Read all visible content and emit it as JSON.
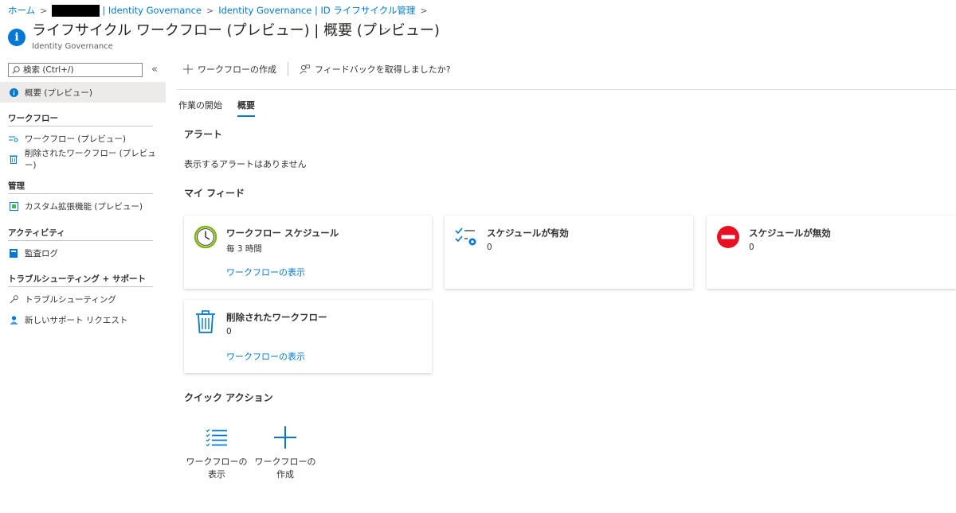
{
  "breadcrumb": {
    "home": "ホーム",
    "tenant_suffix": "| Identity Governance",
    "item2": "Identity Governance | ID ライフサイクル管理"
  },
  "header": {
    "title": "ライフサイクル ワークフロー (プレビュー) | 概要 (プレビュー)",
    "subtitle": "Identity Governance",
    "more": "···"
  },
  "sidebar": {
    "search_placeholder": "検索 (Ctrl+/)",
    "collapse": "«",
    "overview": "概要 (プレビュー)",
    "sections": {
      "workflow": "ワークフロー",
      "manage": "管理",
      "activity": "アクティビティ",
      "troubleshoot": "トラブルシューティング + サポート"
    },
    "items": {
      "workflows": "ワークフロー (プレビュー)",
      "deleted": "削除されたワークフロー (プレビュー)",
      "custom_ext": "カスタム拡張機能 (プレビュー)",
      "audit": "監査ログ",
      "troubleshooting": "トラブルシューティング",
      "support": "新しいサポート リクエスト"
    }
  },
  "toolbar": {
    "create": "ワークフローの作成",
    "feedback": "フィードバックを取得しましたか?"
  },
  "tabs": [
    "作業の開始",
    "概要"
  ],
  "alerts": {
    "heading": "アラート",
    "empty": "表示するアラートはありません"
  },
  "feed": {
    "heading": "マイ フィード",
    "cards": {
      "schedule": {
        "title": "ワークフロー スケジュール",
        "value": "毎 3 時間",
        "link": "ワークフローの表示"
      },
      "enabled": {
        "title": "スケジュールが有効",
        "value": "0"
      },
      "disabled": {
        "title": "スケジュールが無効",
        "value": "0"
      },
      "deleted": {
        "title": "削除されたワークフロー",
        "value": "0",
        "link": "ワークフローの表示"
      }
    }
  },
  "quick_actions": {
    "heading": "クイック アクション",
    "view_line1": "ワークフローの",
    "view_line2": "表示",
    "create_line1": "ワークフローの",
    "create_line2": "作成"
  },
  "colors": {
    "accent": "#0078d4",
    "danger": "#e81123",
    "clock_green": "#7fba00"
  }
}
